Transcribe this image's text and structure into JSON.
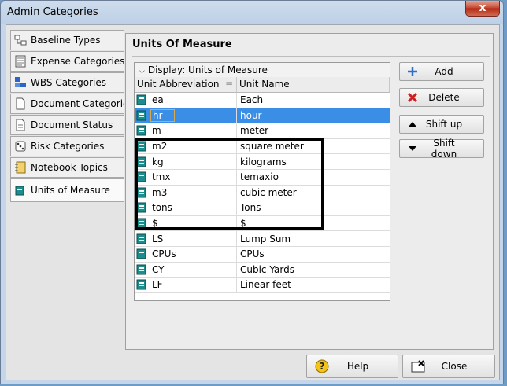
{
  "window": {
    "title": "Admin Categories",
    "close_glyph": "x"
  },
  "sidebar": {
    "items": [
      {
        "label": "Baseline Types",
        "icon": "baseline-icon"
      },
      {
        "label": "Expense Categories",
        "icon": "expense-icon"
      },
      {
        "label": "WBS Categories",
        "icon": "wbs-icon"
      },
      {
        "label": "Document Categories",
        "icon": "document-icon"
      },
      {
        "label": "Document Status",
        "icon": "document-status-icon"
      },
      {
        "label": "Risk Categories",
        "icon": "dice-icon"
      },
      {
        "label": "Notebook Topics",
        "icon": "notebook-icon"
      },
      {
        "label": "Units of Measure",
        "icon": "ruler-icon",
        "active": true
      }
    ]
  },
  "panel": {
    "title": "Units Of Measure",
    "display_label": "Display: Units of Measure",
    "columns": [
      "Unit Abbreviation",
      "Unit Name"
    ],
    "rows": [
      {
        "abbr": "ea",
        "name": "Each"
      },
      {
        "abbr": "hr",
        "name": "hour",
        "selected": true
      },
      {
        "abbr": "m",
        "name": "meter"
      },
      {
        "abbr": "m2",
        "name": "square meter"
      },
      {
        "abbr": "kg",
        "name": "kilograms"
      },
      {
        "abbr": "tmx",
        "name": "temaxio"
      },
      {
        "abbr": "m3",
        "name": "cubic meter"
      },
      {
        "abbr": "tons",
        "name": "Tons"
      },
      {
        "abbr": "$",
        "name": "$"
      },
      {
        "abbr": "LS",
        "name": "Lump Sum"
      },
      {
        "abbr": "CPUs",
        "name": "CPUs"
      },
      {
        "abbr": "CY",
        "name": "Cubic Yards"
      },
      {
        "abbr": "LF",
        "name": "Linear feet"
      }
    ],
    "buttons": {
      "add": "Add",
      "delete": "Delete",
      "shift_up": "Shift up",
      "shift_down": "Shift down"
    }
  },
  "footer": {
    "help": "Help",
    "close": "Close"
  },
  "colors": {
    "selection": "#3a8ee6",
    "delete_icon": "#cc1f1f",
    "add_icon": "#2f6fc5"
  }
}
